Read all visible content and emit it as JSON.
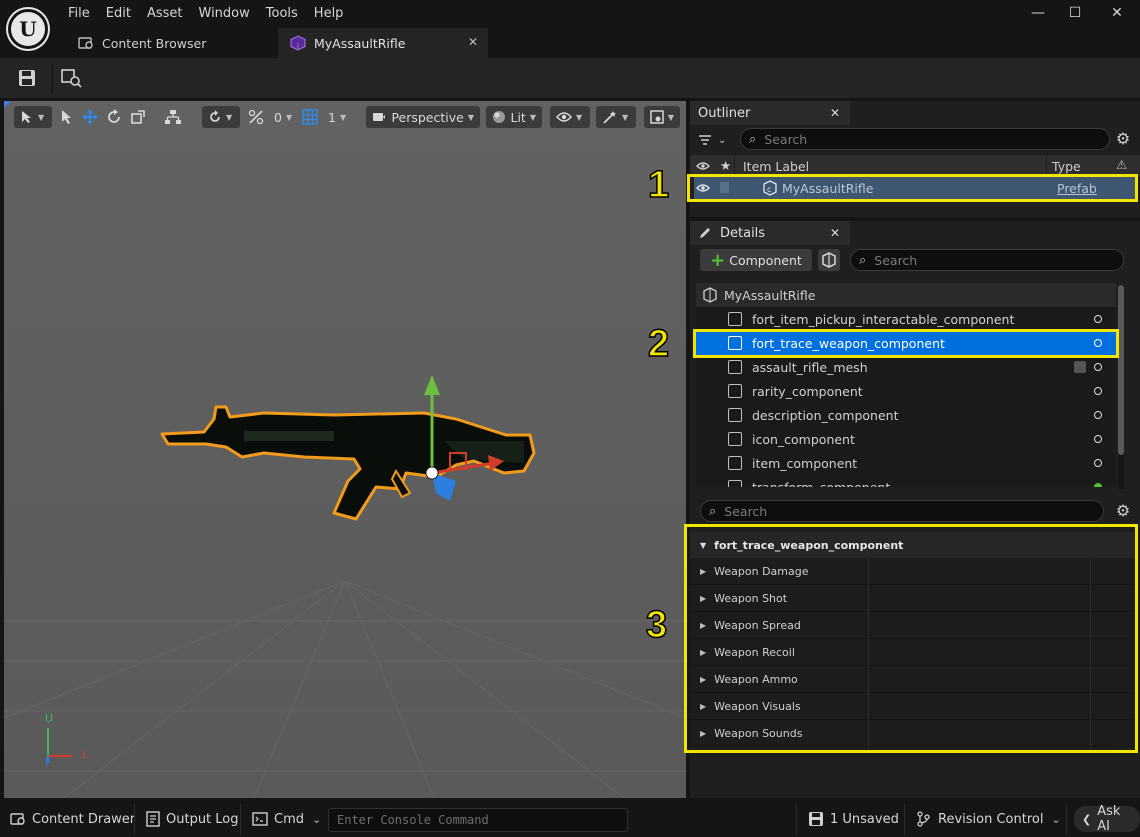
{
  "window": {
    "logo_text": "U",
    "menu": [
      "File",
      "Edit",
      "Asset",
      "Window",
      "Tools",
      "Help"
    ],
    "controls": {
      "minimize": "—",
      "maximize": "☐",
      "close": "✕"
    }
  },
  "tabs": [
    {
      "label": "Content Browser",
      "icon": "content-browser-icon"
    },
    {
      "label": "MyAssaultRifle",
      "icon": "prefab-icon",
      "active": true
    }
  ],
  "viewport_toolbar": {
    "snap_value": "0",
    "grid_value": "1",
    "view_mode": "Perspective",
    "lighting": "Lit"
  },
  "axis": {
    "up": "U",
    "left": "L",
    "forward": "F"
  },
  "outliner": {
    "tab_label": "Outliner",
    "search_placeholder": "Search",
    "columns": {
      "label": "Item Label",
      "type": "Type"
    },
    "rows": [
      {
        "label": "MyAssaultRifle",
        "type": "Prefab"
      }
    ]
  },
  "details": {
    "tab_label": "Details",
    "add_component_label": "Component",
    "search_placeholder": "Search",
    "root": "MyAssaultRifle",
    "components": [
      "fort_item_pickup_interactable_component",
      "fort_trace_weapon_component",
      "assault_rifle_mesh",
      "rarity_component",
      "description_component",
      "icon_component",
      "item_component",
      "transform_component"
    ],
    "selected_component": "fort_trace_weapon_component",
    "props_search_placeholder": "Search",
    "category": "fort_trace_weapon_component",
    "properties": [
      "Weapon Damage",
      "Weapon Shot",
      "Weapon Spread",
      "Weapon Recoil",
      "Weapon Ammo",
      "Weapon Visuals",
      "Weapon Sounds"
    ]
  },
  "callouts": [
    "1",
    "2",
    "3"
  ],
  "statusbar": {
    "content_drawer": "Content Drawer",
    "output_log": "Output Log",
    "cmd": "Cmd",
    "console_placeholder": "Enter Console Command",
    "unsaved": "1 Unsaved",
    "revision_control": "Revision Control",
    "ask_ai": "Ask AI"
  },
  "colors": {
    "highlight": "#f2e600",
    "selection": "#0070e0",
    "outliner_selection": "#3e5670",
    "viewport_bg": "#626262"
  }
}
